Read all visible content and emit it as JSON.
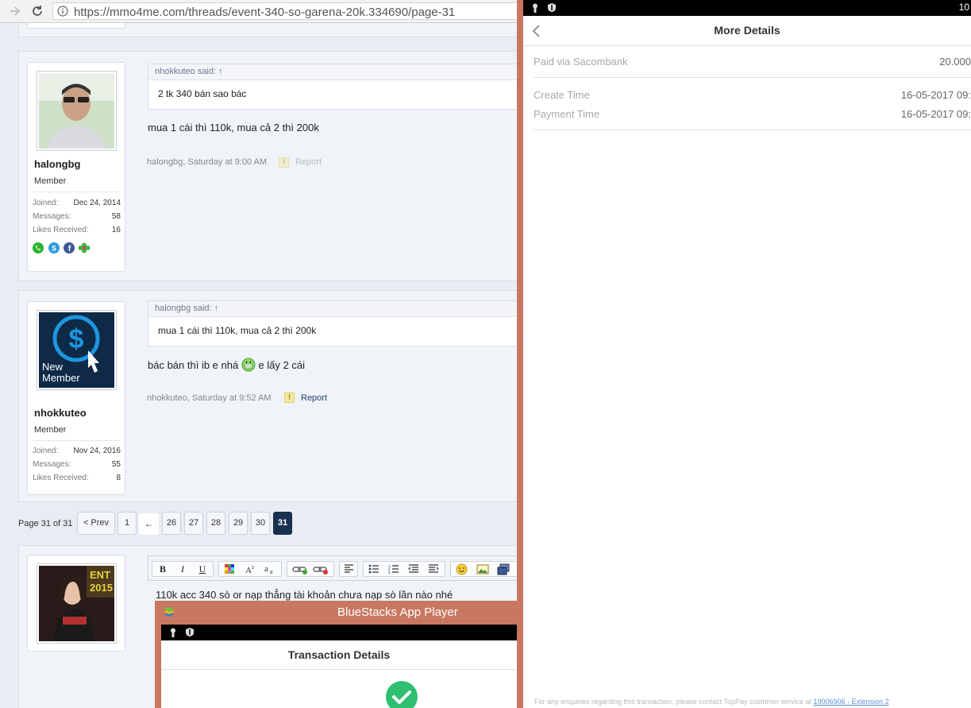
{
  "browser": {
    "url": "https://mmo4me.com/threads/event-340-so-garena-20k.334690/page-31"
  },
  "posts": [
    {
      "username": "halongbg",
      "user_title": "Member",
      "stats": [
        {
          "label": "Joined:",
          "value": "Dec 24, 2014"
        },
        {
          "label": "Messages:",
          "value": "58"
        },
        {
          "label": "Likes Received:",
          "value": "16"
        }
      ],
      "quote_author": "nhokkuteo said: ↑",
      "quote_text": "2 tk 340 bán sao bác",
      "message": "mua 1 cái thì 110k, mua cả 2 thì 200k",
      "meta": "halongbg, Saturday at 9:00 AM",
      "report_label": "Report"
    },
    {
      "username": "nhokkuteo",
      "user_title": "Member",
      "avatar_text": [
        "New",
        "Member"
      ],
      "stats": [
        {
          "label": "Joined:",
          "value": "Nov 24, 2016"
        },
        {
          "label": "Messages:",
          "value": "55"
        },
        {
          "label": "Likes Received:",
          "value": "8"
        }
      ],
      "quote_author": "halongbg said: ↑",
      "quote_text": "mua 1 cái thì 110k, mua cả 2 thì 200k",
      "message_before": "bác bán thì ib e nhá",
      "message_after": "e lấy 2 cái",
      "meta": "nhokkuteo, Saturday at 9:52 AM",
      "report_label": "Report"
    }
  ],
  "pagination": {
    "label": "Page 31 of 31",
    "prev": "< Prev",
    "first": "1",
    "ellipsis": "←",
    "pages": [
      "26",
      "27",
      "28",
      "29",
      "30"
    ],
    "current": "31"
  },
  "editor": {
    "text": "110k acc 340 sò or nạp thẳng tài khoản chưa nạp sò lần nào nhé",
    "toolbar": [
      "B",
      "I",
      "U"
    ]
  },
  "bluestacks": {
    "title": "BlueStacks App Player",
    "screen_title": "Transaction Details"
  },
  "app": {
    "clock": "10",
    "title": "More Details",
    "paid_label": "Paid via Sacombank",
    "paid_value": "20.000",
    "create_label": "Create Time",
    "create_value": "16-05-2017 09:",
    "payment_label": "Payment Time",
    "payment_value": "16-05-2017 09:",
    "footer_text": "For any enquiries regarding this transaction, please contact TopPay customer service at",
    "footer_link": "19006906 - Extension 2"
  },
  "colors": {
    "accent_dark": "#18314f",
    "bluestacks_frame": "#c87860",
    "link": "#5b8fd6"
  }
}
